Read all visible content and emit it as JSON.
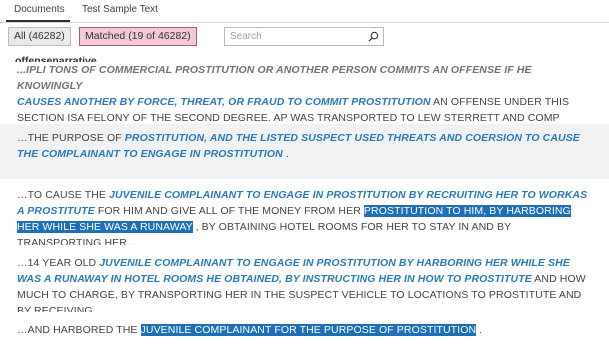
{
  "tabs": [
    "Documents",
    "Test Sample Text"
  ],
  "filter": {
    "all_label": "All (46282)",
    "matched_label": "Matched (19 of 46282)",
    "search_placeholder": "Search"
  },
  "column_header": "offensenarrative",
  "rows": [
    {
      "cutoff": "...IPLI TONS OF COMMERCIAL PROSTITUTION OR ANOTHER PERSON COMMITS AN OFFENSE IF HE KNOWINGLY",
      "hl1": "CAUSES ANOTHER BY FORCE, THREAT, OR FRAUD TO COMMIT PROSTITUTION",
      "t1": " AN OFFENSE UNDER THIS SECTION ISA FELONY OF THE SECOND DEGREE. AP WAS TRANSPORTED TO LEW STERRETT AND COMP WAS…"
    },
    {
      "t1": "…THE PURPOSE OF ",
      "hl1": "PROSTITUTION, AND THE LISTED SUSPECT USED THREATS AND COERSION TO CAUSE THE COMPLAINANT TO ENGAGE IN PROSTITUTION",
      "t2": " ."
    },
    {
      "t1": "…TO CAUSE THE ",
      "hl1": "JUVENILE COMPLAINANT TO ENGAGE IN PROSTITUTION BY RECRUITING HER TO WORKAS A PROSTITUTE",
      "t2": " FOR HIM AND GIVE ALL OF THE MONEY FROM HER ",
      "sel1": "PROSTITUTION TO HIM, BY HARBORING HER WHILE SHE WAS A RUNAWAY",
      "t3": " , BY OBTAINING HOTEL ROOMS FOR HER TO STAY IN AND BY TRANSPORTING HER…"
    },
    {
      "t1": "…14 YEAR OLD ",
      "hl1": "JUVENILE COMPLAINANT TO ENGAGE IN PROSTITUTION BY HARBORING HER WHILE SHE WAS A RUNAWAY IN HOTEL ROOMS HE OBTAINED, BY INSTRUCTING HER IN HOW TO PROSTITUTE",
      "t2": " AND HOW MUCH TO CHARGE, BY TRANSPORTING HER IN THE SUSPECT VEHICLE TO LOCATIONS TO PROSTITUTE AND BY RECEIVING…"
    },
    {
      "t1": "…AND HARBORED THE ",
      "sel1": "JUVENILE COMPLAINANT FOR THE PURPOSE OF PROSTITUTION",
      "t2": " ."
    }
  ]
}
